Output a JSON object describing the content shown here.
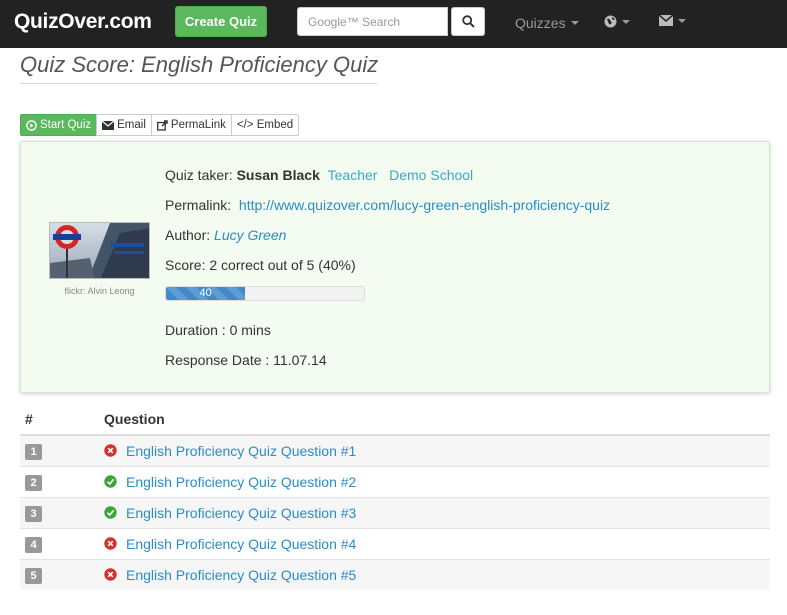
{
  "navbar": {
    "brand": "QuizOver.com",
    "create_label": "Create Quiz",
    "search_placeholder": "Google™ Search",
    "quizzes_label": "Quizzes",
    "globe_icon": "globe-icon",
    "mail_icon": "envelope-icon"
  },
  "page": {
    "title": "Quiz Score: English Proficiency Quiz"
  },
  "actions": {
    "start_label": "Start Quiz",
    "email_label": "Email",
    "permalink_label": "PermaLink",
    "embed_label": "</> Embed"
  },
  "summary": {
    "photo_credit": "flickr: Alvin Leong",
    "taker_label": "Quiz taker:",
    "taker_name": "Susan Black",
    "taker_role": "Teacher",
    "taker_school": "Demo School",
    "permalink_label": "Permalink:",
    "permalink_url": "http://www.quizover.com/lucy-green-english-proficiency-quiz",
    "author_label": "Author:",
    "author_name": "Lucy Green",
    "score_text": "Score: 2 correct out of 5 (40%)",
    "progress_value": "40",
    "progress_percent": 40,
    "duration_text": "Duration : 0 mins",
    "response_date_text": "Response Date : 11.07.14"
  },
  "table": {
    "col_num": "#",
    "col_question": "Question",
    "rows": [
      {
        "num": "1",
        "title": "English Proficiency Quiz Question #1",
        "correct": false
      },
      {
        "num": "2",
        "title": "English Proficiency Quiz Question #2",
        "correct": true
      },
      {
        "num": "3",
        "title": "English Proficiency Quiz Question #3",
        "correct": true
      },
      {
        "num": "4",
        "title": "English Proficiency Quiz Question #4",
        "correct": false
      },
      {
        "num": "5",
        "title": "English Proficiency Quiz Question #5",
        "correct": false
      }
    ]
  },
  "colors": {
    "navbar_bg": "#222222",
    "success": "#5cb85c",
    "link": "#2a8cc8",
    "progress": "#428bca",
    "panel_bg": "#f4fbf1",
    "wrong": "#d9302b",
    "right": "#3aa63a"
  }
}
